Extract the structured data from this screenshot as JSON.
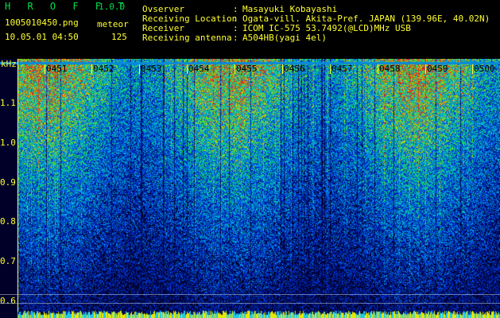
{
  "header": {
    "app_title": "H R O F F T",
    "app_version": "1.0.0",
    "filename": "1005010450.png",
    "mode": "meteor",
    "datetime": "10.05.01 04:50",
    "count": "125",
    "fields": [
      {
        "label": "Ovserver",
        "value": "Masayuki Kobayashi"
      },
      {
        "label": "Receiving Location",
        "value": "Ogata-vill. Akita-Pref. JAPAN (139.96E, 40.02N)"
      },
      {
        "label": "Receiver",
        "value": "ICOM IC-575 53.7492(@LCD)MHz USB"
      },
      {
        "label": "Receiving antenna",
        "value": "A504HB(yagi 4el)"
      }
    ]
  },
  "spectrogram": {
    "unit_label": "kHz",
    "y_ticks": [
      "1.1",
      "1.0",
      "0.9",
      "0.8",
      "0.7",
      "0.6"
    ],
    "time_marks": [
      "0451",
      "0452",
      "0453",
      "0454",
      "0455",
      "0456",
      "0457",
      "0458",
      "0459",
      "0500"
    ],
    "colors": {
      "label": "#ffff30",
      "title": "#00e04a"
    }
  }
}
